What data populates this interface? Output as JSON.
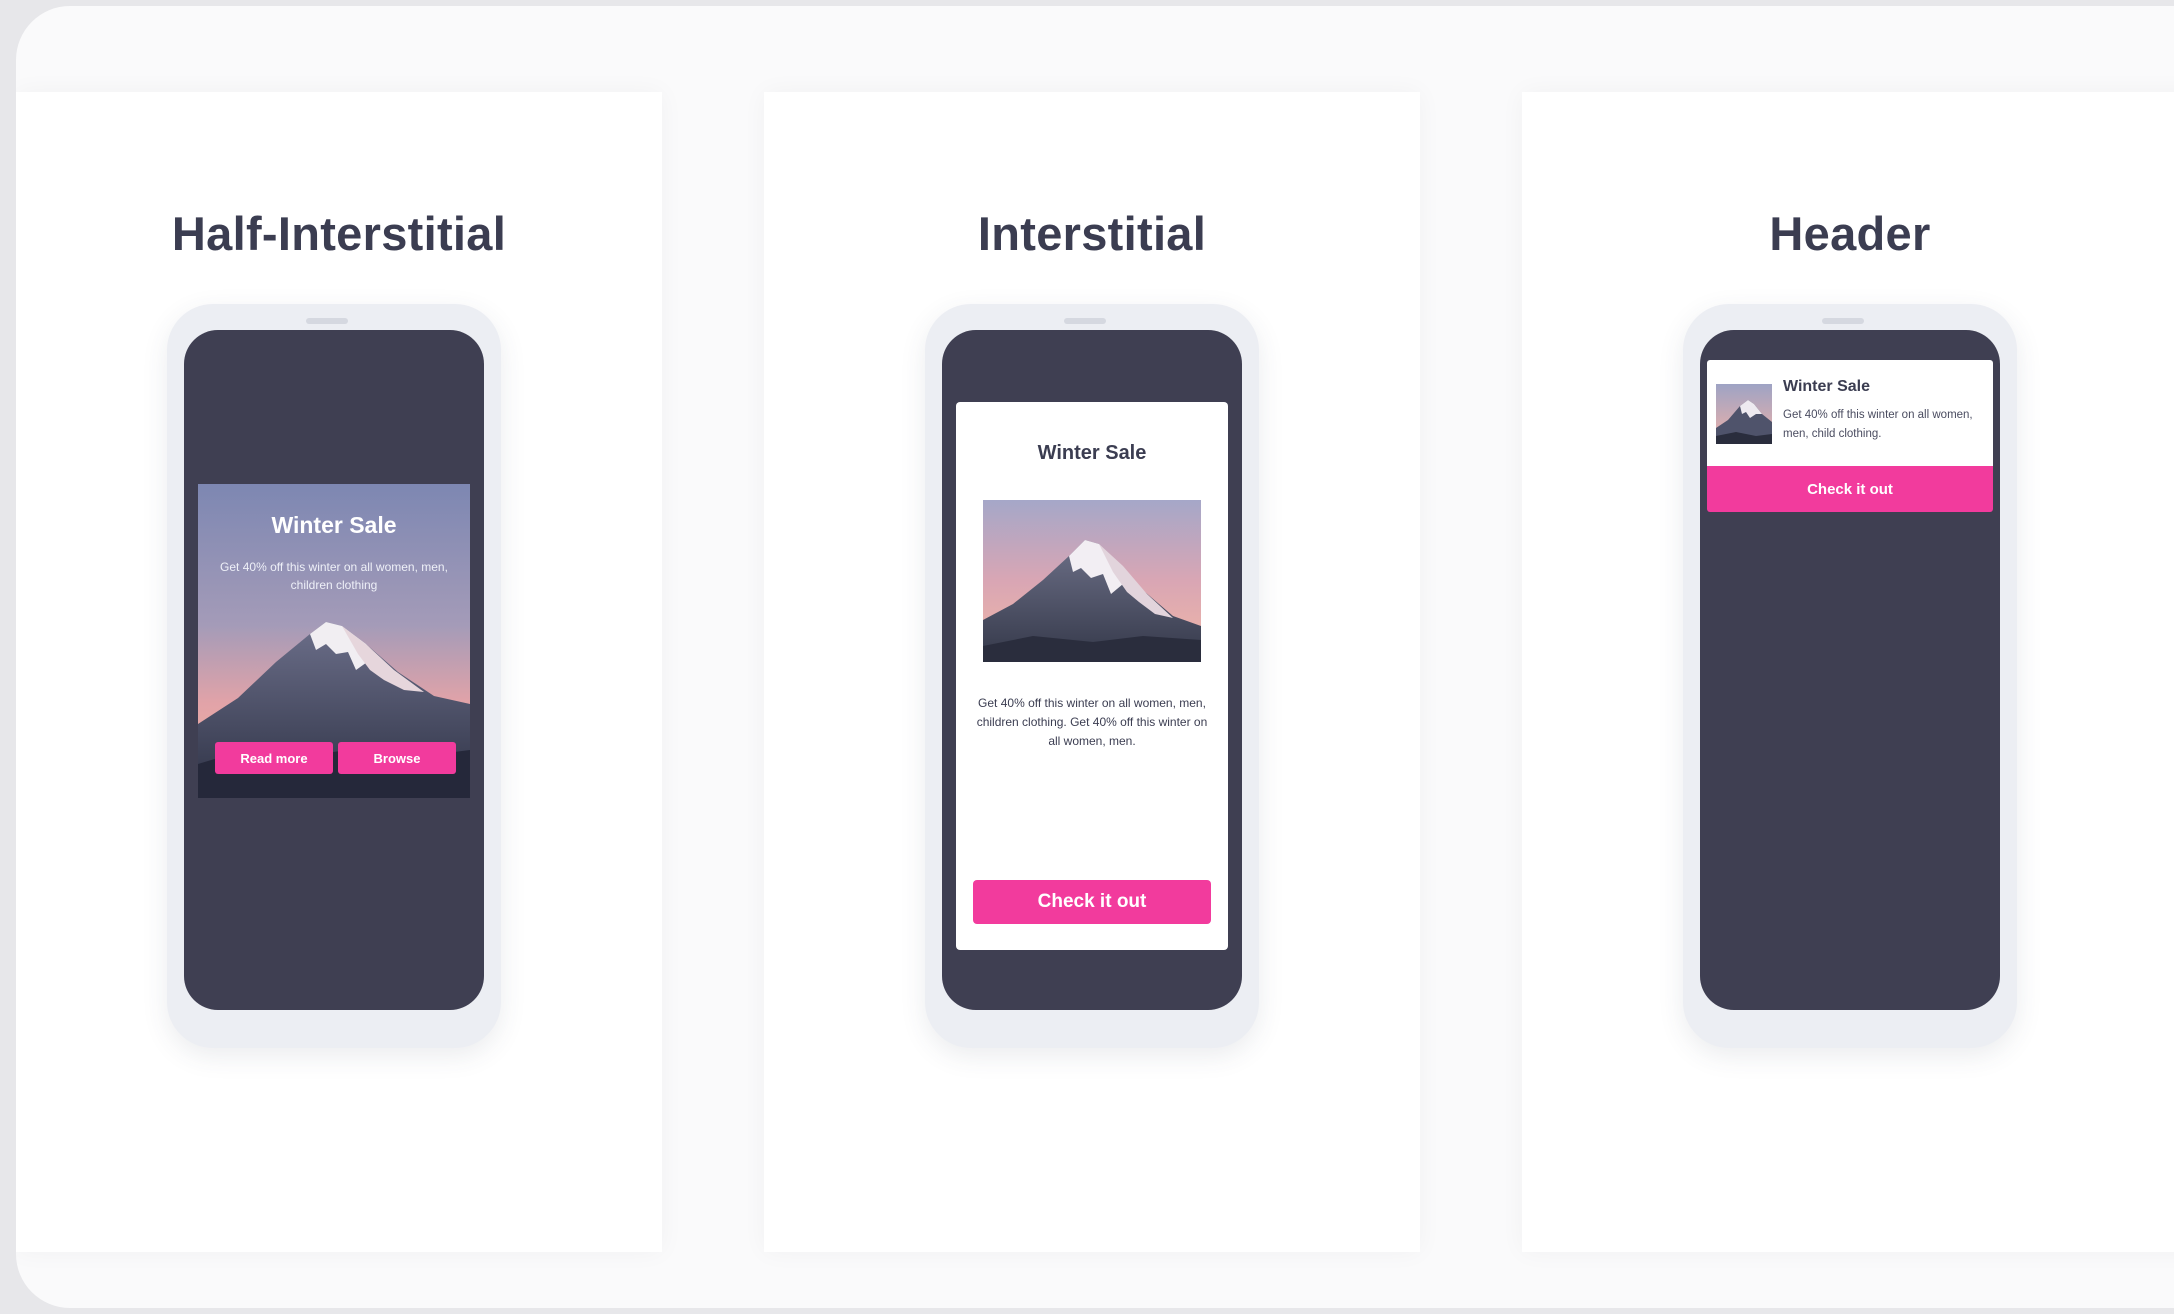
{
  "panels": [
    {
      "title": "Half-Interstitial",
      "message": {
        "title": "Winter Sale",
        "text": "Get 40% off this winter on all women, men, children clothing",
        "buttons": [
          "Read more",
          "Browse"
        ]
      }
    },
    {
      "title": "Interstitial",
      "message": {
        "title": "Winter Sale",
        "text": "Get 40% off this winter on all women, men, children clothing. Get 40% off this winter on all women, men.",
        "button": "Check it out"
      }
    },
    {
      "title": "Header",
      "message": {
        "title": "Winter Sale",
        "text": "Get 40% off this winter on all women, men, child clothing.",
        "button": "Check it out"
      }
    }
  ],
  "colors": {
    "accent": "#f23b9d",
    "phone_screen": "#3f3f52",
    "title_text": "#3b3d51"
  },
  "icons": {
    "image": "mountain-image"
  }
}
